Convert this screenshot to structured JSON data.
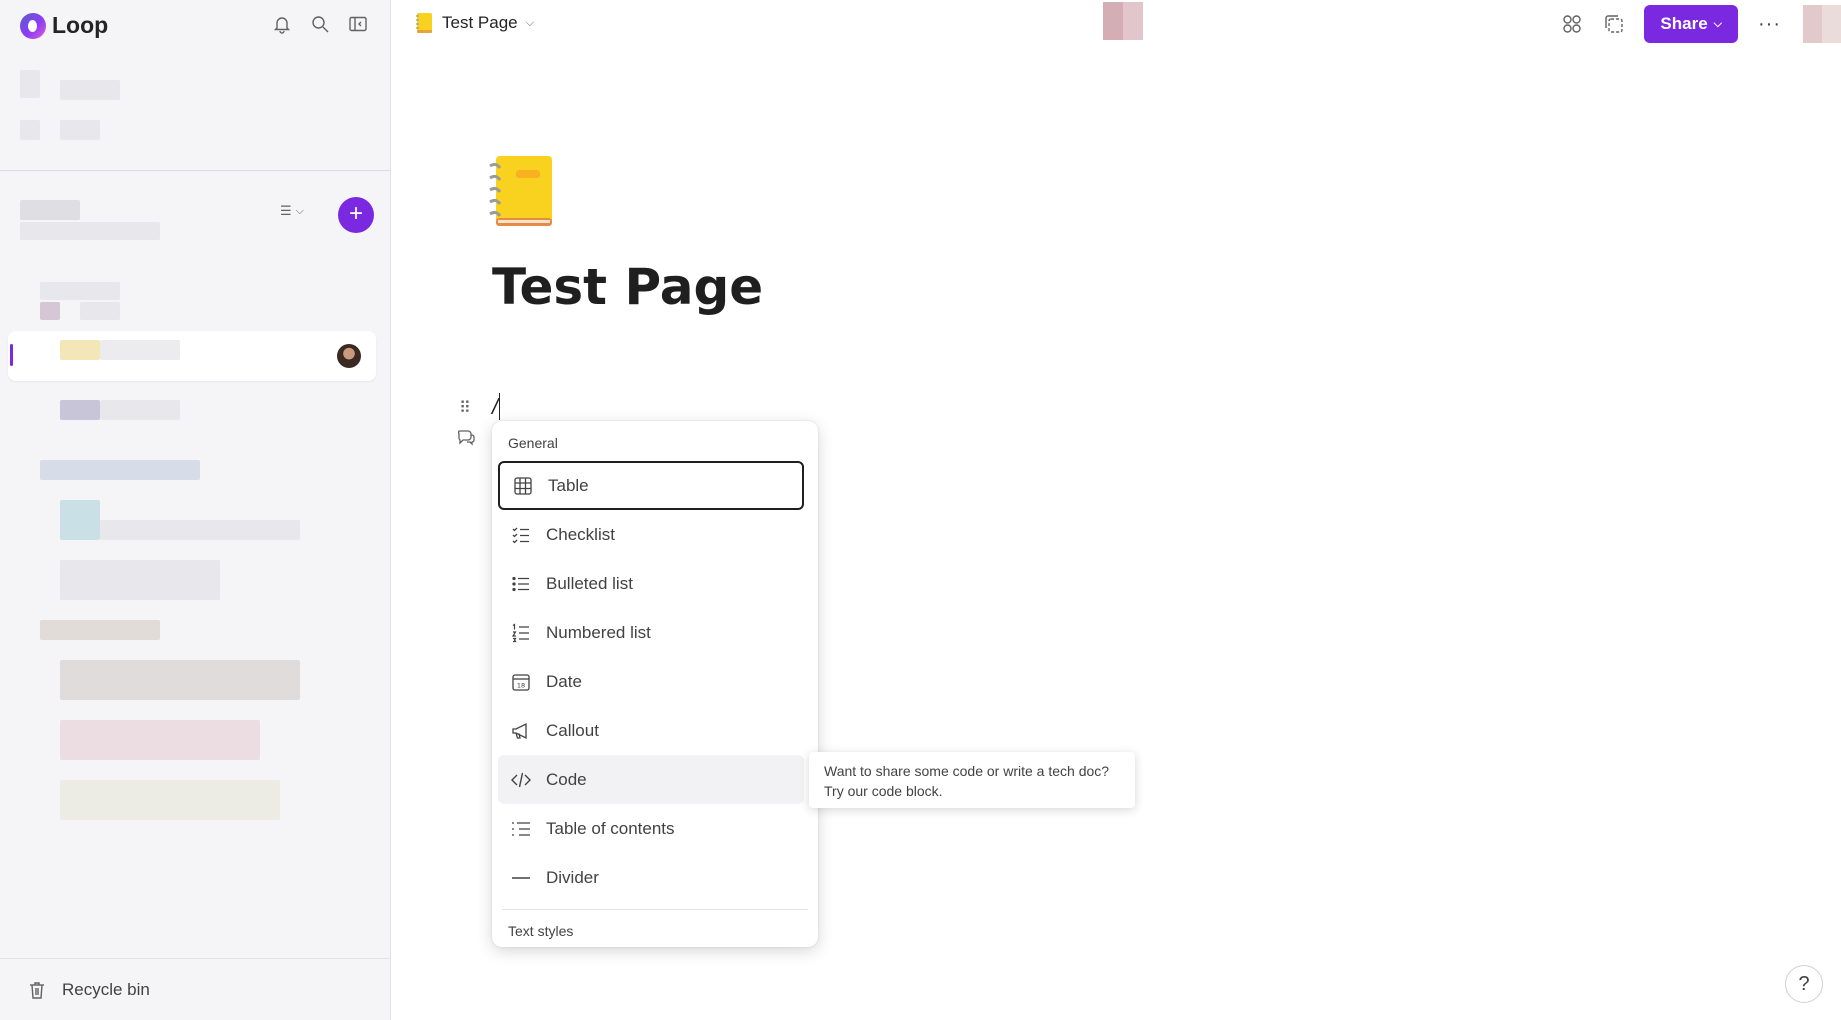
{
  "app": {
    "name": "Loop"
  },
  "sidebar": {
    "recycle_bin_label": "Recycle bin",
    "add_icon": "plus-icon"
  },
  "topbar": {
    "page_title": "Test Page",
    "share_label": "Share",
    "more_label": "···"
  },
  "page": {
    "title": "Test Page",
    "typed_text": "/"
  },
  "menu": {
    "section_general": "General",
    "section_text_styles": "Text styles",
    "items": [
      {
        "label": "Table",
        "icon": "table-icon"
      },
      {
        "label": "Checklist",
        "icon": "checklist-icon"
      },
      {
        "label": "Bulleted list",
        "icon": "bulleted-list-icon"
      },
      {
        "label": "Numbered list",
        "icon": "numbered-list-icon"
      },
      {
        "label": "Date",
        "icon": "calendar-icon"
      },
      {
        "label": "Callout",
        "icon": "megaphone-icon"
      },
      {
        "label": "Code",
        "icon": "code-icon"
      },
      {
        "label": "Table of contents",
        "icon": "table-of-contents-icon"
      },
      {
        "label": "Divider",
        "icon": "divider-icon"
      }
    ],
    "selected_item": "Table",
    "hovered_item": "Code"
  },
  "tooltip": {
    "text": "Want to share some code or write a tech doc? Try our code block."
  },
  "help": {
    "label": "?"
  },
  "colors": {
    "accent": "#7a29e0",
    "sidebar_bg": "#f5f5f7"
  }
}
